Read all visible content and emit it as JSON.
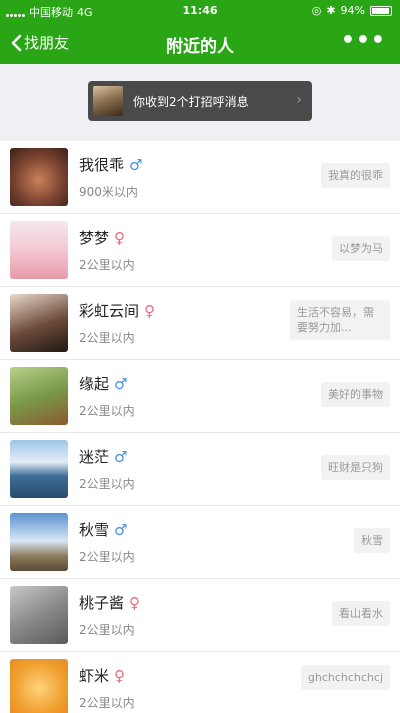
{
  "status_bar": {
    "carrier": "中国移动",
    "network": "4G",
    "time": "11:46",
    "battery": "94%"
  },
  "nav": {
    "back_label": "找朋友",
    "title": "附近的人",
    "more": "•••"
  },
  "greeting": {
    "text": "你收到2个打招呼消息"
  },
  "people": [
    {
      "name": "我很乖",
      "gender": "male",
      "gender_symbol": "♂",
      "distance": "900米以内",
      "signature": "我真的很乖"
    },
    {
      "name": "梦梦",
      "gender": "female",
      "gender_symbol": "♀",
      "distance": "2公里以内",
      "signature": "以梦为马"
    },
    {
      "name": "彩虹云间",
      "gender": "female",
      "gender_symbol": "♀",
      "distance": "2公里以内",
      "signature": "生活不容易，需要努力加..."
    },
    {
      "name": "缘起",
      "gender": "male",
      "gender_symbol": "♂",
      "distance": "2公里以内",
      "signature": "美好的事物"
    },
    {
      "name": "迷茫",
      "gender": "male",
      "gender_symbol": "♂",
      "distance": "2公里以内",
      "signature": "旺财是只狗"
    },
    {
      "name": "秋雪",
      "gender": "male",
      "gender_symbol": "♂",
      "distance": "2公里以内",
      "signature": "秋雪"
    },
    {
      "name": "桃子酱",
      "gender": "female",
      "gender_symbol": "♀",
      "distance": "2公里以内",
      "signature": "看山看水"
    },
    {
      "name": "虾米",
      "gender": "female",
      "gender_symbol": "♀",
      "distance": "2公里以内",
      "signature": "ghchchchchcj"
    }
  ],
  "colors": {
    "brand_green": "#2aa515",
    "male": "#4a90e2",
    "female": "#f06a7a"
  }
}
